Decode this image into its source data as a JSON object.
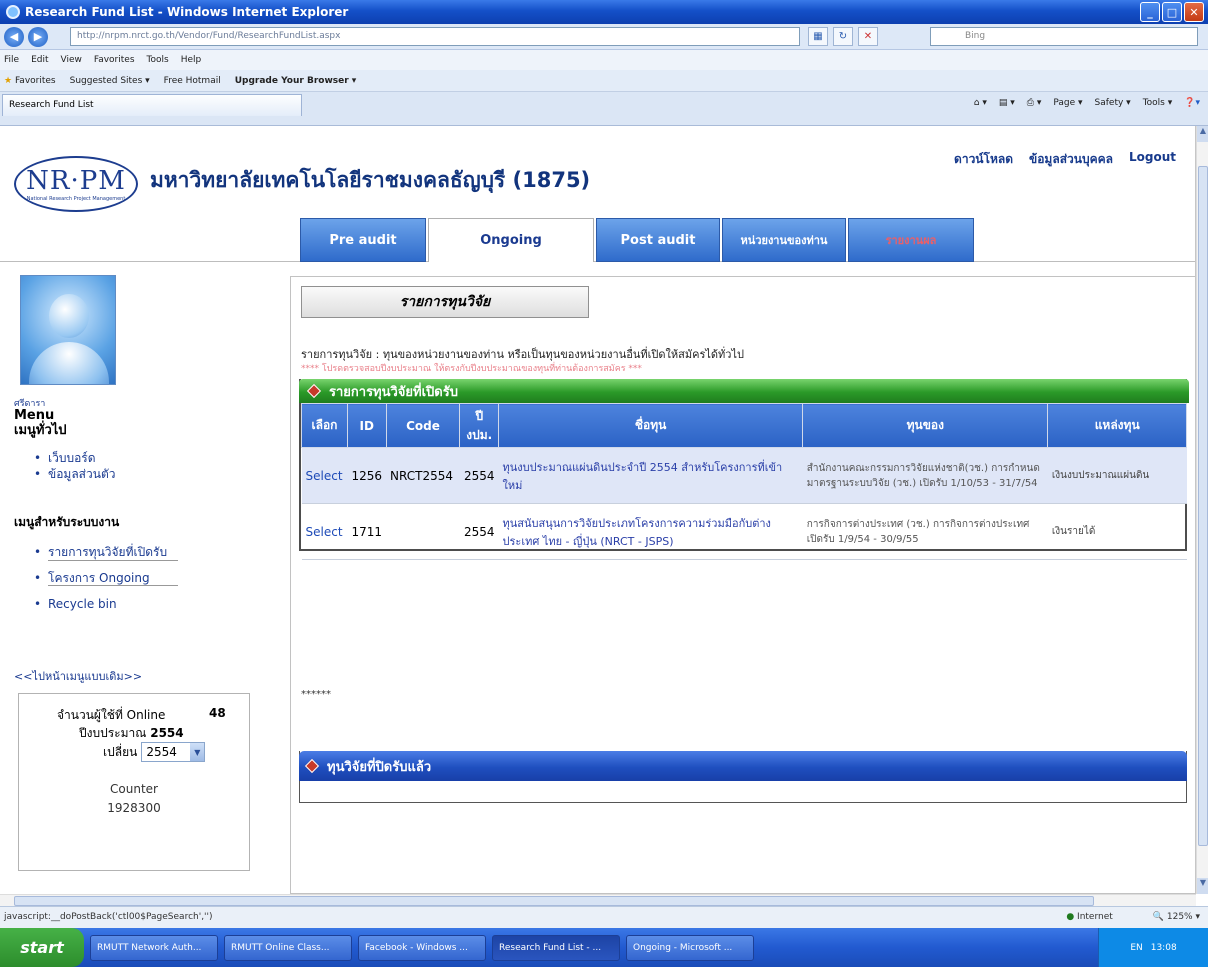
{
  "browser": {
    "window_title": "Research Fund List - Windows Internet Explorer",
    "address": "http://nrpm.nrct.go.th/Vendor/Fund/ResearchFundList.aspx",
    "search_placeholder": "Bing",
    "menu": [
      "File",
      "Edit",
      "View",
      "Favorites",
      "Tools",
      "Help"
    ],
    "favorites": {
      "label": "Favorites",
      "items": [
        "Suggested Sites ▾",
        "Free Hotmail",
        "Upgrade Your Browser ▾"
      ]
    },
    "tab_title": "Research Fund List",
    "commands": [
      "Page ▾",
      "Safety ▾",
      "Tools ▾"
    ],
    "status_text": "javascript:__doPostBack('ctl00$PageSearch','')",
    "status_zone": "Internet",
    "zoom": "125%"
  },
  "taskbar": {
    "start_label": "start",
    "buttons": [
      "RMUTT Network Auth...",
      "RMUTT Online Class...",
      "Facebook - Windows ...",
      "Research Fund List - ...",
      "Ongoing - Microsoft ..."
    ],
    "active_index": 3,
    "tray_lang": "EN",
    "clock": "13:08"
  },
  "header": {
    "logo_text": "NR·PM",
    "logo_sub": "National Research Project Management",
    "university": "มหาวิทยาลัยเทคโนโลยีราชมงคลธัญบุรี (1875)",
    "links": [
      "ดาวน์โหลด",
      "ข้อมูลส่วนบุคคล",
      "Logout"
    ]
  },
  "tabs": {
    "pre": "Pre audit",
    "ongoing": "Ongoing",
    "post": "Post audit",
    "unit": "หน่วยงานของท่าน",
    "extra": "รายงานผล"
  },
  "sidebar": {
    "username": "ศรีดารา",
    "menu_title": "Menu",
    "menu_subtitle": "เมนูทั่วไป",
    "general_items": [
      "เว็บบอร์ด",
      "ข้อมูลส่วนตัว"
    ],
    "system_title": "เมนูสำหรับระบบงาน",
    "system_items": [
      "รายการทุนวิจัยที่เปิดรับ",
      "โครงการ Ongoing",
      "Recycle bin"
    ],
    "more_link": "<<ไปหน้าเมนูแบบเดิม>>",
    "online_label": "จำนวนผู้ใช้ที่ Online",
    "online_count": "48",
    "budget_label": "ปีงบประมาณ",
    "budget_year": "2554",
    "change_label": "เปลี่ยน",
    "year_value": "2554",
    "counter_label": "Counter",
    "counter_value": "1928300"
  },
  "main": {
    "title": "รายการทุนวิจัย",
    "description": "รายการทุนวิจัย : ทุนของหน่วยงานของท่าน หรือเป็นทุนของหน่วยงานอื่นที่เปิดให้สมัครได้ทั่วไป",
    "note": "**** โปรดตรวจสอบปีงบประมาณ ให้ตรงกับปีงบประมาณของทุนที่ท่านต้องการสมัคร ***",
    "open_section_title": "รายการทุนวิจัยที่เปิดรับ",
    "columns": [
      "เลือก",
      "ID",
      "Code",
      "ปี งปม.",
      "ชื่อทุน",
      "ทุนของ",
      "แหล่งทุน"
    ],
    "rows": [
      {
        "select": "Select",
        "id": "1256",
        "code": "NRCT2554",
        "year": "2554",
        "name": "ทุนงบประมาณแผ่นดินประจำปี 2554 สำหรับโครงการที่เข้าใหม่",
        "owner": "สำนักงานคณะกรรมการวิจัยแห่งชาติ(วช.) การกำหนดมาตรฐานระบบวิจัย (วช.) เปิดรับ 1/10/53 - 31/7/54",
        "source": "เงินงบประมาณแผ่นดิน"
      },
      {
        "select": "Select",
        "id": "1711",
        "code": "",
        "year": "2554",
        "name": "ทุนสนับสนุนการวิจัยประเภทโครงการความร่วมมือกับต่างประเทศ ไทย - ญี่ปุ่น (NRCT - JSPS)",
        "owner": "การกิจการต่างประเทศ (วช.) การกิจการต่างประเทศ เปิดรับ 1/9/54 - 30/9/55",
        "source": "เงินรายได้"
      }
    ],
    "stars": "******",
    "closed_section_title": "ทุนวิจัยที่ปิดรับแล้ว"
  }
}
